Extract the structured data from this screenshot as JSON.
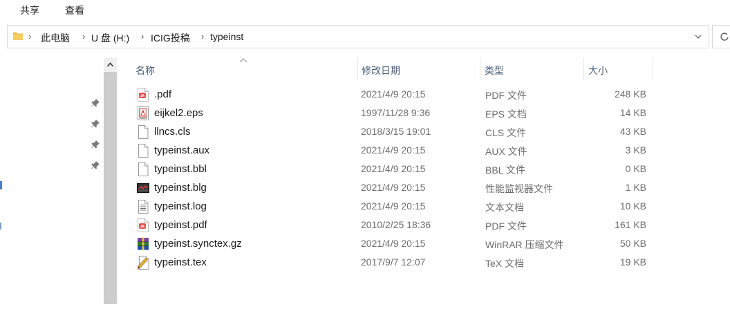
{
  "ribbon": {
    "tabs": [
      "共享",
      "查看"
    ]
  },
  "address": {
    "crumbs": [
      "此电脑",
      "U 盘 (H:)",
      "ICIG投稿",
      "typeinst"
    ]
  },
  "columns": {
    "name": "名称",
    "date": "修改日期",
    "type": "类型",
    "size": "大小"
  },
  "files": [
    {
      "name": ".pdf",
      "date": "2021/4/9 20:15",
      "type": "PDF 文件",
      "size": "248 KB",
      "icon": "pdf-icon"
    },
    {
      "name": "eijkel2.eps",
      "date": "1997/11/28 9:36",
      "type": "EPS 文档",
      "size": "14 KB",
      "icon": "eps-icon"
    },
    {
      "name": "llncs.cls",
      "date": "2018/3/15 19:01",
      "type": "CLS 文件",
      "size": "43 KB",
      "icon": "blank-file-icon"
    },
    {
      "name": "typeinst.aux",
      "date": "2021/4/9 20:15",
      "type": "AUX 文件",
      "size": "3 KB",
      "icon": "blank-file-icon"
    },
    {
      "name": "typeinst.bbl",
      "date": "2021/4/9 20:15",
      "type": "BBL 文件",
      "size": "0 KB",
      "icon": "blank-file-icon"
    },
    {
      "name": "typeinst.blg",
      "date": "2021/4/9 20:15",
      "type": "性能监视器文件",
      "size": "1 KB",
      "icon": "performance-monitor-icon"
    },
    {
      "name": "typeinst.log",
      "date": "2021/4/9 20:15",
      "type": "文本文档",
      "size": "10 KB",
      "icon": "text-file-icon"
    },
    {
      "name": "typeinst.pdf",
      "date": "2010/2/25 18:36",
      "type": "PDF 文件",
      "size": "161 KB",
      "icon": "pdf-icon"
    },
    {
      "name": "typeinst.synctex.gz",
      "date": "2021/4/9 20:15",
      "type": "WinRAR 压缩文件",
      "size": "50 KB",
      "icon": "winrar-archive-icon"
    },
    {
      "name": "typeinst.tex",
      "date": "2017/9/7 12:07",
      "type": "TeX 文档",
      "size": "19 KB",
      "icon": "tex-file-icon"
    }
  ]
}
